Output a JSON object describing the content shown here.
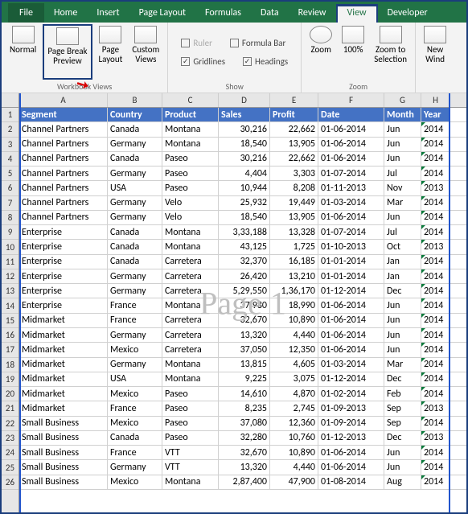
{
  "tabs": {
    "file": "File",
    "home": "Home",
    "insert": "Insert",
    "pagelayout": "Page Layout",
    "formulas": "Formulas",
    "data": "Data",
    "review": "Review",
    "view": "View",
    "developer": "Developer"
  },
  "ribbon": {
    "views": {
      "group": "Workbook Views",
      "normal": "Normal",
      "pbp1": "Page Break",
      "pbp2": "Preview",
      "pl1": "Page",
      "pl2": "Layout",
      "cv1": "Custom",
      "cv2": "Views"
    },
    "show": {
      "group": "Show",
      "ruler": "Ruler",
      "formulabar": "Formula Bar",
      "gridlines": "Gridlines",
      "headings": "Headings"
    },
    "zoom": {
      "group": "Zoom",
      "zoom": "Zoom",
      "hundred": "100%",
      "zts1": "Zoom to",
      "zts2": "Selection",
      "nw1": "New",
      "nw2": "Wind"
    }
  },
  "watermark": "Page 1",
  "col_letters": [
    "A",
    "B",
    "C",
    "D",
    "E",
    "F",
    "G",
    "H"
  ],
  "headers": [
    "Segment",
    "Country",
    "Product",
    "Sales",
    "Profit",
    "Date",
    "Month",
    "Year"
  ],
  "rows": [
    {
      "seg": "Channel Partners",
      "cty": "Canada",
      "prod": "Montana",
      "sales": "30,216",
      "profit": "22,662",
      "date": "01-06-2014",
      "mon": "Jun",
      "yr": "2014"
    },
    {
      "seg": "Channel Partners",
      "cty": "Germany",
      "prod": "Montana",
      "sales": "18,540",
      "profit": "13,905",
      "date": "01-06-2014",
      "mon": "Jun",
      "yr": "2014"
    },
    {
      "seg": "Channel Partners",
      "cty": "Canada",
      "prod": "Paseo",
      "sales": "30,216",
      "profit": "22,662",
      "date": "01-06-2014",
      "mon": "Jun",
      "yr": "2014"
    },
    {
      "seg": "Channel Partners",
      "cty": "Germany",
      "prod": "Paseo",
      "sales": "4,404",
      "profit": "3,303",
      "date": "01-07-2014",
      "mon": "Jul",
      "yr": "2014"
    },
    {
      "seg": "Channel Partners",
      "cty": "USA",
      "prod": "Paseo",
      "sales": "10,944",
      "profit": "8,208",
      "date": "01-11-2013",
      "mon": "Nov",
      "yr": "2013"
    },
    {
      "seg": "Channel Partners",
      "cty": "Germany",
      "prod": "Velo",
      "sales": "25,932",
      "profit": "19,449",
      "date": "01-03-2014",
      "mon": "Mar",
      "yr": "2014"
    },
    {
      "seg": "Channel Partners",
      "cty": "Germany",
      "prod": "Velo",
      "sales": "18,540",
      "profit": "13,905",
      "date": "01-06-2014",
      "mon": "Jun",
      "yr": "2014"
    },
    {
      "seg": "Enterprise",
      "cty": "Canada",
      "prod": "Montana",
      "sales": "3,33,188",
      "profit": "13,328",
      "date": "01-07-2014",
      "mon": "Jul",
      "yr": "2014"
    },
    {
      "seg": "Enterprise",
      "cty": "Canada",
      "prod": "Montana",
      "sales": "43,125",
      "profit": "1,725",
      "date": "01-10-2013",
      "mon": "Oct",
      "yr": "2013"
    },
    {
      "seg": "Enterprise",
      "cty": "Canada",
      "prod": "Carretera",
      "sales": "32,370",
      "profit": "16,185",
      "date": "01-01-2014",
      "mon": "Jan",
      "yr": "2014"
    },
    {
      "seg": "Enterprise",
      "cty": "Germany",
      "prod": "Carretera",
      "sales": "26,420",
      "profit": "13,210",
      "date": "01-01-2014",
      "mon": "Jan",
      "yr": "2014"
    },
    {
      "seg": "Enterprise",
      "cty": "Germany",
      "prod": "Carretera",
      "sales": "5,29,550",
      "profit": "1,36,170",
      "date": "01-12-2014",
      "mon": "Dec",
      "yr": "2014"
    },
    {
      "seg": "Enterprise",
      "cty": "France",
      "prod": "Montana",
      "sales": "37,980",
      "profit": "18,990",
      "date": "01-06-2014",
      "mon": "Jun",
      "yr": "2014"
    },
    {
      "seg": "Midmarket",
      "cty": "France",
      "prod": "Carretera",
      "sales": "32,670",
      "profit": "10,890",
      "date": "01-06-2014",
      "mon": "Jun",
      "yr": "2014"
    },
    {
      "seg": "Midmarket",
      "cty": "Germany",
      "prod": "Carretera",
      "sales": "13,320",
      "profit": "4,440",
      "date": "01-06-2014",
      "mon": "Jun",
      "yr": "2014"
    },
    {
      "seg": "Midmarket",
      "cty": "Mexico",
      "prod": "Carretera",
      "sales": "37,050",
      "profit": "12,350",
      "date": "01-06-2014",
      "mon": "Jun",
      "yr": "2014"
    },
    {
      "seg": "Midmarket",
      "cty": "Germany",
      "prod": "Montana",
      "sales": "13,815",
      "profit": "4,605",
      "date": "01-03-2014",
      "mon": "Mar",
      "yr": "2014"
    },
    {
      "seg": "Midmarket",
      "cty": "USA",
      "prod": "Montana",
      "sales": "9,225",
      "profit": "3,075",
      "date": "01-12-2014",
      "mon": "Dec",
      "yr": "2014"
    },
    {
      "seg": "Midmarket",
      "cty": "Mexico",
      "prod": "Paseo",
      "sales": "14,610",
      "profit": "4,870",
      "date": "01-02-2014",
      "mon": "Feb",
      "yr": "2014"
    },
    {
      "seg": "Midmarket",
      "cty": "France",
      "prod": "Paseo",
      "sales": "8,235",
      "profit": "2,745",
      "date": "01-09-2013",
      "mon": "Sep",
      "yr": "2013"
    },
    {
      "seg": "Small Business",
      "cty": "Mexico",
      "prod": "Paseo",
      "sales": "37,080",
      "profit": "12,360",
      "date": "01-09-2014",
      "mon": "Sep",
      "yr": "2014"
    },
    {
      "seg": "Small Business",
      "cty": "Canada",
      "prod": "Paseo",
      "sales": "32,280",
      "profit": "10,760",
      "date": "01-12-2013",
      "mon": "Dec",
      "yr": "2013"
    },
    {
      "seg": "Small Business",
      "cty": "France",
      "prod": "VTT",
      "sales": "32,670",
      "profit": "10,890",
      "date": "01-06-2014",
      "mon": "Jun",
      "yr": "2014"
    },
    {
      "seg": "Small Business",
      "cty": "Germany",
      "prod": "VTT",
      "sales": "13,320",
      "profit": "4,440",
      "date": "01-06-2014",
      "mon": "Jun",
      "yr": "2014"
    },
    {
      "seg": "Small Business",
      "cty": "Mexico",
      "prod": "Montana",
      "sales": "2,87,400",
      "profit": "47,900",
      "date": "01-08-2014",
      "mon": "Aug",
      "yr": "2014"
    }
  ]
}
